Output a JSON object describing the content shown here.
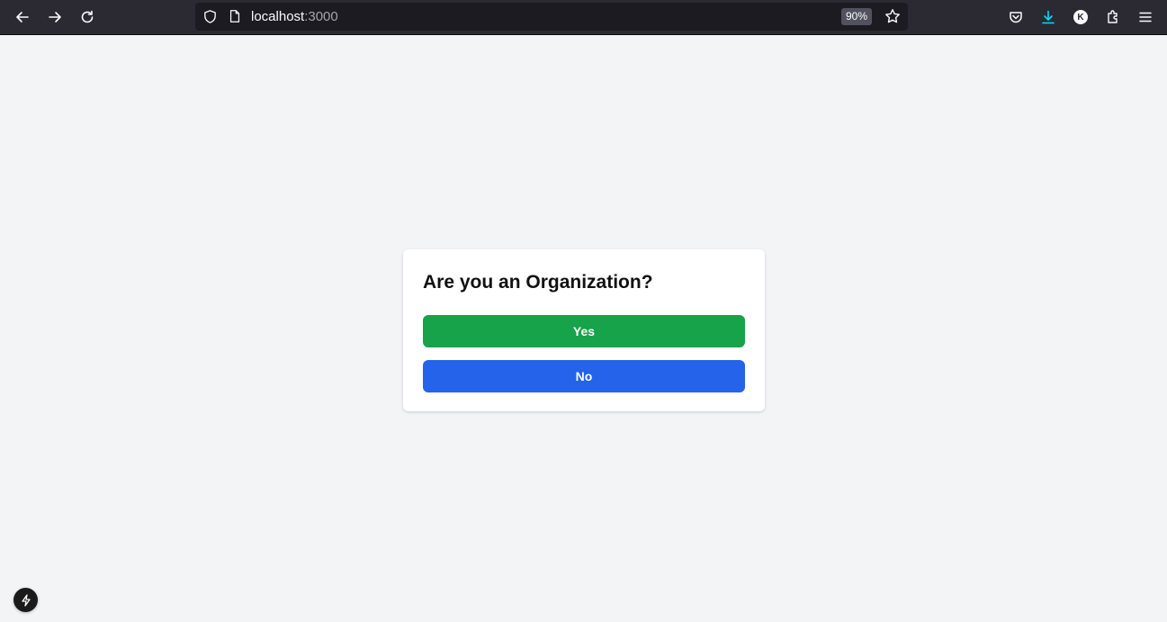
{
  "browser": {
    "url_host": "localhost",
    "url_port": ":3000",
    "zoom_level": "90%",
    "account_initial": "K",
    "icons": {
      "back": "arrow-left-icon",
      "forward": "arrow-right-icon",
      "reload": "reload-icon",
      "tracking_protection": "shield-icon",
      "page_info": "page-icon",
      "bookmark": "star-icon",
      "pocket": "pocket-icon",
      "downloads": "download-icon",
      "extensions": "puzzle-icon",
      "menu": "hamburger-menu-icon"
    },
    "colors": {
      "toolbar": "#2b2a33",
      "urlbar": "#1c1b22",
      "download_accent": "#00ddff"
    }
  },
  "dialog": {
    "title": "Are you an Organization?",
    "yes_label": "Yes",
    "no_label": "No",
    "colors": {
      "yes": "#16a34a",
      "no": "#2563eb",
      "page_background": "#f3f4f6"
    }
  },
  "dev_indicator": {
    "icon": "lightning-bolt-icon"
  }
}
